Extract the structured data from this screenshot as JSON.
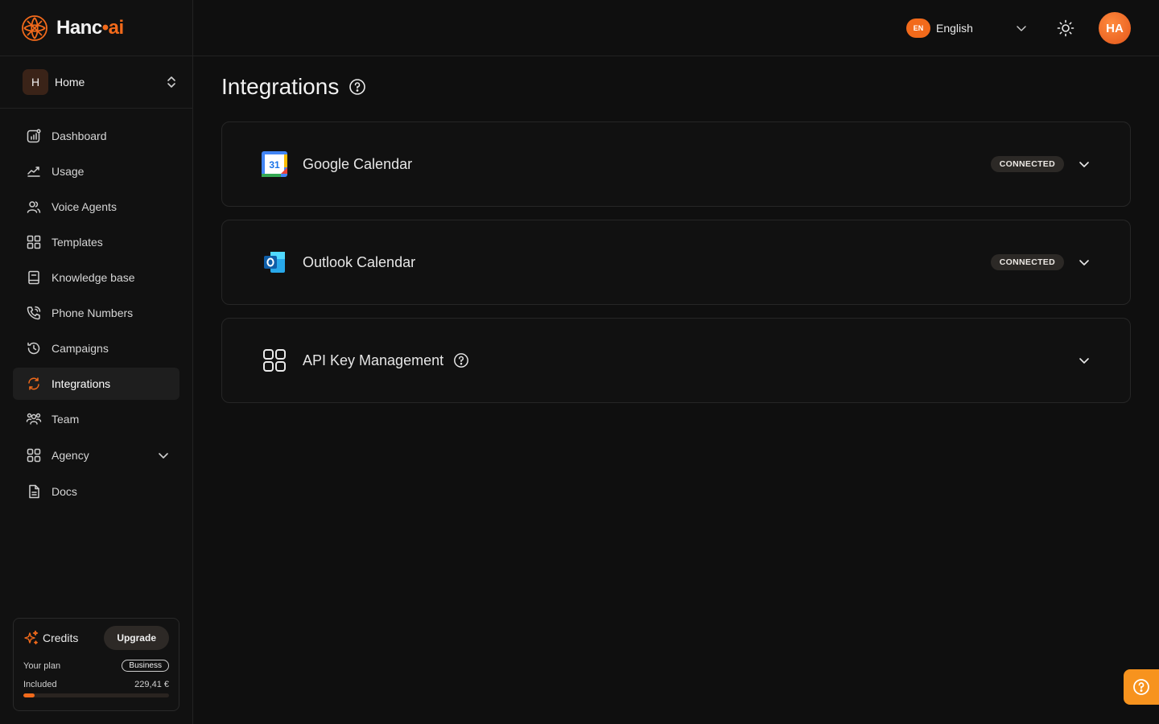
{
  "app": {
    "logo_main": "Hanc",
    "logo_dot": "•",
    "logo_suffix": "ai"
  },
  "workspace": {
    "initial": "H",
    "name": "Home"
  },
  "sidebar": {
    "items": [
      {
        "label": "Dashboard",
        "icon": "dashboard-icon"
      },
      {
        "label": "Usage",
        "icon": "chart-line-icon"
      },
      {
        "label": "Voice Agents",
        "icon": "users-icon"
      },
      {
        "label": "Templates",
        "icon": "grid-icon"
      },
      {
        "label": "Knowledge base",
        "icon": "book-icon"
      },
      {
        "label": "Phone Numbers",
        "icon": "phone-icon"
      },
      {
        "label": "Campaigns",
        "icon": "history-icon"
      },
      {
        "label": "Integrations",
        "icon": "refresh-icon",
        "active": true
      },
      {
        "label": "Team",
        "icon": "team-icon"
      },
      {
        "label": "Agency",
        "icon": "grid-icon",
        "expandable": true
      },
      {
        "label": "Docs",
        "icon": "document-icon"
      }
    ]
  },
  "credits": {
    "title": "Credits",
    "upgrade_label": "Upgrade",
    "plan_label": "Your plan",
    "plan_value": "Business",
    "included_label": "Included",
    "included_value": "229,41 €",
    "progress_fraction": 0.08
  },
  "header": {
    "lang_code": "EN",
    "lang_name": "English"
  },
  "user": {
    "initials": "HA"
  },
  "page": {
    "title": "Integrations"
  },
  "integrations": [
    {
      "title": "Google Calendar",
      "status": "CONNECTED",
      "icon": "google-calendar-icon"
    },
    {
      "title": "Outlook Calendar",
      "status": "CONNECTED",
      "icon": "outlook-icon"
    },
    {
      "title": "API Key Management",
      "status": "",
      "icon": "grid-icon"
    }
  ],
  "colors": {
    "accent": "#f26a1b",
    "background": "#0f0f0f",
    "help_fab": "#f7931e"
  }
}
